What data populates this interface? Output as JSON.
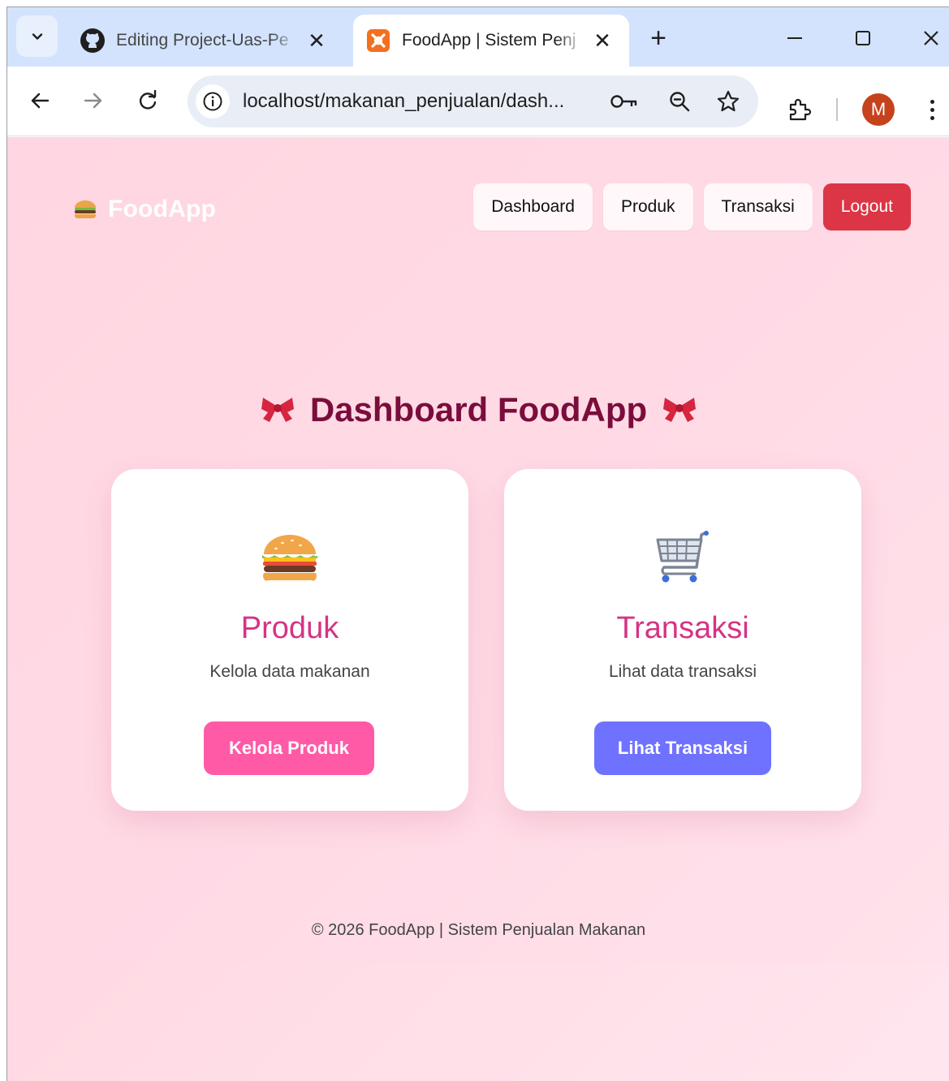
{
  "browser": {
    "tabs": [
      {
        "title": "Editing Project-Uas-Pe",
        "favicon": "github-icon",
        "active": false
      },
      {
        "title": "FoodApp | Sistem Penj",
        "favicon": "xampp-icon",
        "active": true
      }
    ],
    "url": "localhost/makanan_penjualan/dash...",
    "profile_initial": "M",
    "colors": {
      "tabstrip": "#d3e3fd",
      "avatar": "#c5421c"
    }
  },
  "navbar": {
    "brand": "FoodApp",
    "brand_icon": "burger-icon",
    "links": [
      "Dashboard",
      "Produk",
      "Transaksi"
    ],
    "logout": "Logout"
  },
  "main": {
    "title": "Dashboard FoodApp",
    "title_icon": "ribbon-icon",
    "cards": [
      {
        "icon": "burger-icon",
        "title": "Produk",
        "description": "Kelola data makanan",
        "button": "Kelola Produk"
      },
      {
        "icon": "shopping-cart-icon",
        "title": "Transaksi",
        "description": "Lihat data transaksi",
        "button": "Lihat Transaksi"
      }
    ]
  },
  "footer": {
    "text": "© 2026 FoodApp | Sistem Penjualan Makanan"
  },
  "colors": {
    "accent_pink": "#d63384",
    "heading": "#7a0d3c",
    "logout": "#dc3545",
    "produk_button": "#ff5aa5",
    "transaksi_button": "#6f72ff"
  }
}
